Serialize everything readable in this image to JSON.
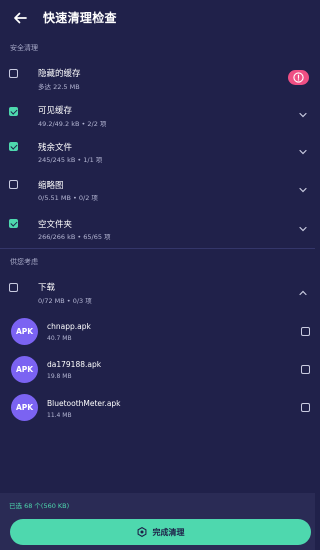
{
  "header": {
    "title": "快速清理检查"
  },
  "sections": {
    "safe": "安全清理",
    "consider": "供您考虑"
  },
  "items": [
    {
      "title": "隐藏的缓存",
      "sub": "多达 22.5 MB",
      "checked": false,
      "trailing": "warning-icon"
    },
    {
      "title": "可见缓存",
      "sub": "49.2/49.2 kB • 2/2 项",
      "checked": true,
      "trailing": "chevron-down-icon"
    },
    {
      "title": "残余文件",
      "sub": "245/245 kB • 1/1 项",
      "checked": true,
      "trailing": "chevron-down-icon"
    },
    {
      "title": "缩略图",
      "sub": "0/5.51 MB • 0/2 项",
      "checked": false,
      "trailing": "chevron-down-icon"
    },
    {
      "title": "空文件夹",
      "sub": "266/266 kB • 65/65 项",
      "checked": true,
      "trailing": "chevron-down-icon"
    }
  ],
  "downloads": {
    "title": "下载",
    "sub": "0/72 MB • 0/3 项",
    "checked": false,
    "trailing": "chevron-up-icon",
    "files": [
      {
        "avatar": "APK",
        "name": "chnapp.apk",
        "size": "40.7 MB"
      },
      {
        "avatar": "APK",
        "name": "da179188.apk",
        "size": "19.8 MB"
      },
      {
        "avatar": "APK",
        "name": "BluetoothMeter.apk",
        "size": "11.4 MB"
      }
    ]
  },
  "footer": {
    "selected_text": "已选 68 个(560 KB)",
    "button_label": "完成清理"
  },
  "colors": {
    "background": "#20214a",
    "accent": "#4ed8ae",
    "warning": "#ef4f84",
    "apk_avatar": "#7b63f2"
  }
}
